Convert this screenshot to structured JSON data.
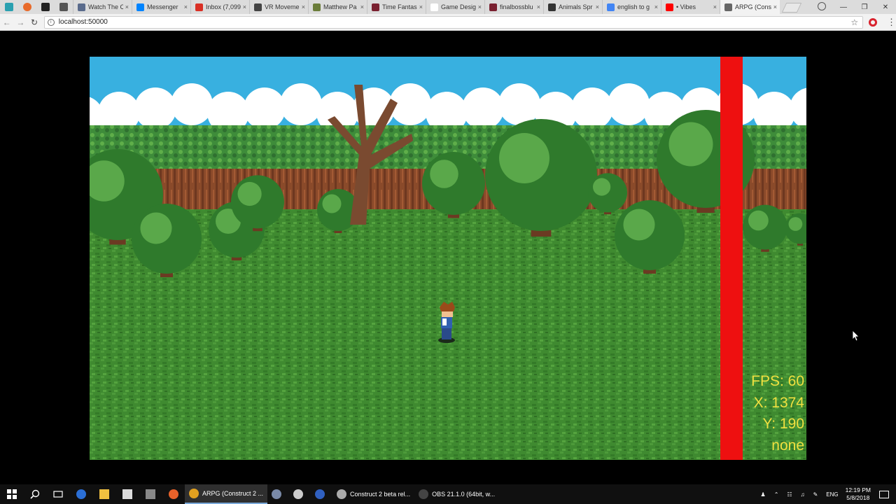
{
  "browser": {
    "tabs": [
      {
        "label": "Watch The C",
        "color": "#5a6b8c"
      },
      {
        "label": "Messenger",
        "color": "#0084ff"
      },
      {
        "label": "Inbox (7,099",
        "color": "#d93025"
      },
      {
        "label": "VR Moveme",
        "color": "#444444"
      },
      {
        "label": "Matthew Pa",
        "color": "#6b7d3a"
      },
      {
        "label": "Time Fantas",
        "color": "#7a2030"
      },
      {
        "label": "Game Desig",
        "color": "#ffffff"
      },
      {
        "label": "finalbossblu",
        "color": "#7a2030"
      },
      {
        "label": "Animals Spr",
        "color": "#333333"
      },
      {
        "label": "english to g",
        "color": "#4285f4"
      },
      {
        "label": "• Vibes",
        "color": "#ff0000"
      },
      {
        "label": "ARPG (Cons",
        "color": "#666666"
      }
    ],
    "active_tab_index": 11,
    "url": "localhost:50000",
    "tab_close_glyph": "×",
    "window_controls": {
      "minimize": "—",
      "restore": "❐",
      "close": "✕"
    }
  },
  "game": {
    "hud": {
      "fps": "FPS: 60",
      "x": "X: 1374",
      "y": "Y: 190",
      "state": "none"
    },
    "colors": {
      "sky": "#38b0e0",
      "cloud": "#ffffff",
      "grass": "#3f8a30",
      "cliff": "#8a4a2a",
      "hedge": "#3e8c3a",
      "red_bar": "#ee1010",
      "hud_text": "#f0e040"
    }
  },
  "taskbar": {
    "apps": [
      {
        "label": "ARPG (Construct 2 ...",
        "color": "#e0a020",
        "active": true
      },
      {
        "label": "",
        "color": "#7a8aa8",
        "active": false
      },
      {
        "label": "",
        "color": "#cccccc",
        "active": false
      },
      {
        "label": "",
        "color": "#3060c0",
        "active": false
      },
      {
        "label": "Construct 2 beta rel...",
        "color": "#aaaaaa",
        "active": false
      },
      {
        "label": "OBS 21.1.0 (64bit, w...",
        "color": "#444444",
        "active": false
      }
    ],
    "tray": {
      "language": "ENG",
      "time": "12:19 PM",
      "date": "5/8/2018"
    }
  }
}
